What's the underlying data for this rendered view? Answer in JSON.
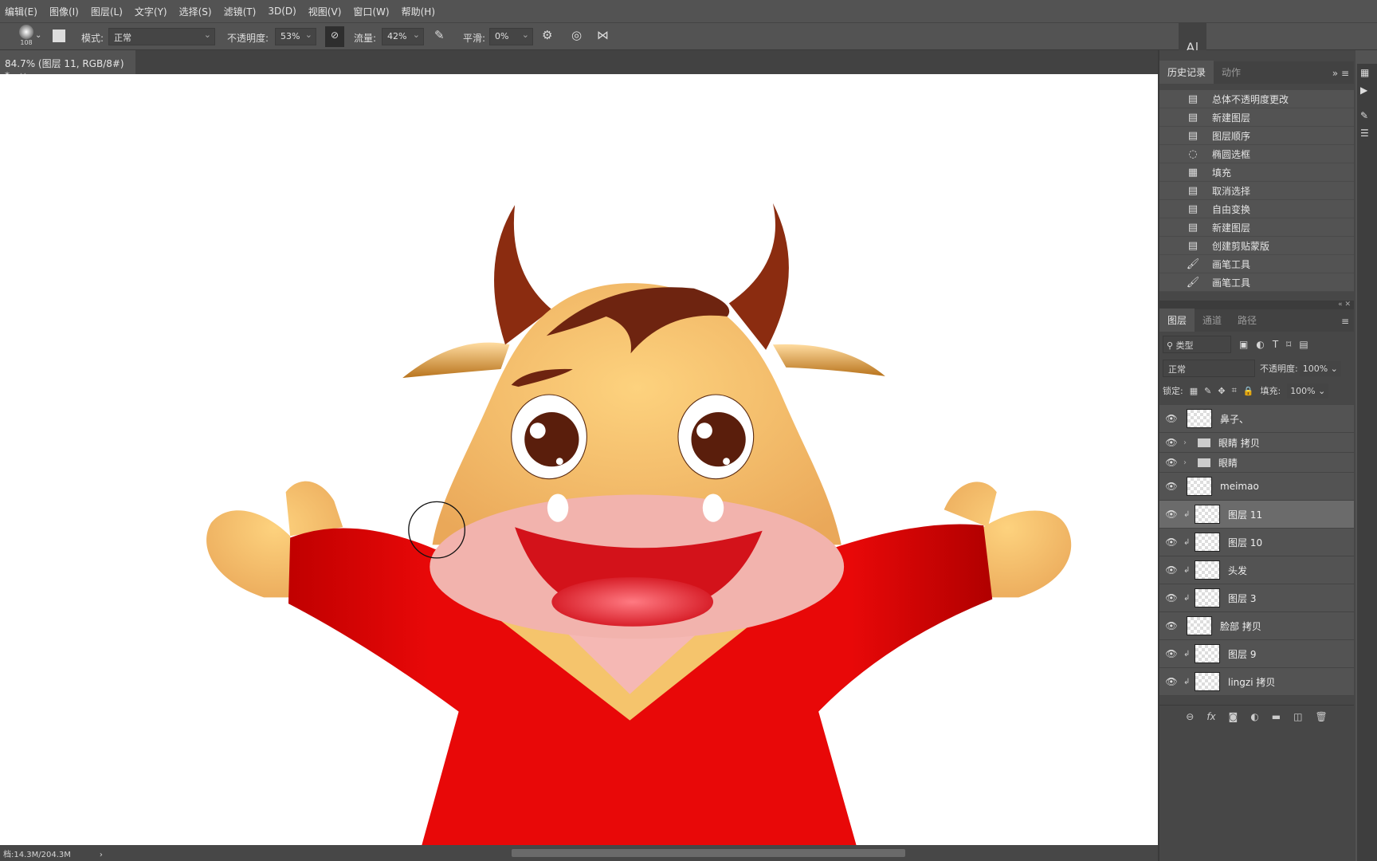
{
  "menu": [
    "编辑(E)",
    "图像(I)",
    "图层(L)",
    "文字(Y)",
    "选择(S)",
    "滤镜(T)",
    "3D(D)",
    "视图(V)",
    "窗口(W)",
    "帮助(H)"
  ],
  "options": {
    "brush_size": "108",
    "mode_label": "模式:",
    "mode_value": "正常",
    "opacity_label": "不透明度:",
    "opacity_value": "53%",
    "flow_label": "流量:",
    "flow_value": "42%",
    "smoothing_label": "平滑:",
    "smoothing_value": "0%"
  },
  "document_tab": {
    "title": "84.7% (图层 11, RGB/8#) *",
    "close": "×"
  },
  "status": {
    "doc_size": "档:14.3M/204.3M"
  },
  "history": {
    "tabs": [
      "历史记录",
      "动作"
    ],
    "items": [
      {
        "icon": "document-icon",
        "label": "总体不透明度更改"
      },
      {
        "icon": "document-icon",
        "label": "新建图层"
      },
      {
        "icon": "document-icon",
        "label": "图层顺序"
      },
      {
        "icon": "ellipse-marquee-icon",
        "label": "椭圆选框"
      },
      {
        "icon": "fill-icon",
        "label": "填充"
      },
      {
        "icon": "document-icon",
        "label": "取消选择"
      },
      {
        "icon": "document-icon",
        "label": "自由变换"
      },
      {
        "icon": "document-icon",
        "label": "新建图层"
      },
      {
        "icon": "document-icon",
        "label": "创建剪贴蒙版"
      },
      {
        "icon": "brush-icon",
        "label": "画笔工具"
      },
      {
        "icon": "brush-icon",
        "label": "画笔工具"
      }
    ]
  },
  "layers": {
    "tabs": [
      "图层",
      "通道",
      "路径"
    ],
    "filter": "类型",
    "blend_mode": "正常",
    "opacity_label": "不透明度:",
    "opacity_value": "100%",
    "lock_label": "锁定:",
    "fill_label": "填充:",
    "fill_value": "100%",
    "items": [
      {
        "name": "鼻子、",
        "type": "layer",
        "clipped": false,
        "selected": false
      },
      {
        "name": "眼睛 拷贝",
        "type": "group",
        "clipped": false,
        "selected": false
      },
      {
        "name": "眼睛",
        "type": "group",
        "clipped": false,
        "selected": false
      },
      {
        "name": "meimao",
        "type": "layer",
        "clipped": false,
        "selected": false
      },
      {
        "name": "图层 11",
        "type": "layer",
        "clipped": true,
        "selected": true
      },
      {
        "name": "图层 10",
        "type": "layer",
        "clipped": true,
        "selected": false
      },
      {
        "name": "头发",
        "type": "layer",
        "clipped": true,
        "selected": false
      },
      {
        "name": "图层 3",
        "type": "layer",
        "clipped": true,
        "selected": false
      },
      {
        "name": "脸部 拷贝",
        "type": "layer",
        "clipped": false,
        "selected": false
      },
      {
        "name": "图层 9",
        "type": "layer",
        "clipped": true,
        "selected": false
      },
      {
        "name": "lingzi 拷贝",
        "type": "layer",
        "clipped": true,
        "selected": false
      }
    ]
  },
  "colors": {
    "shirt": "#e00a0a",
    "skin": "#f7c36a",
    "muzzle": "#f2b3ad",
    "horn": "#8b2c10",
    "hair": "#6e2410",
    "mouth": "#d3121a"
  }
}
